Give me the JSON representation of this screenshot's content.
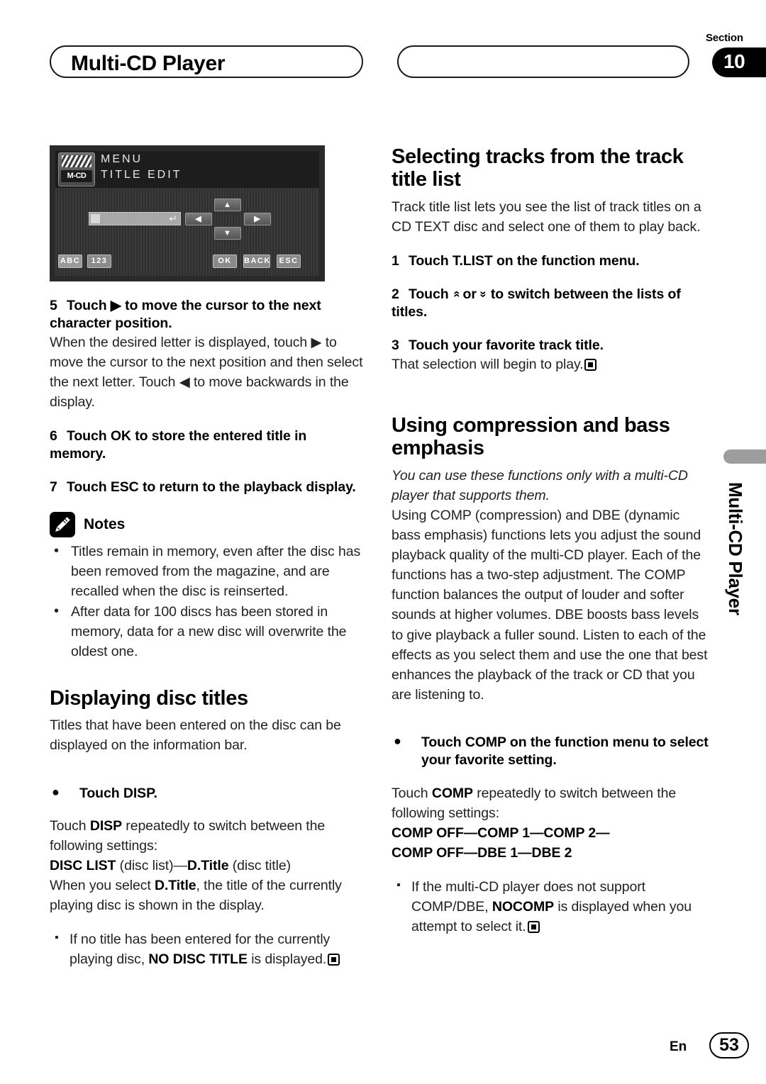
{
  "header": {
    "left_pill_title": "Multi-CD Player",
    "right_pill_title": "",
    "section_word": "Section",
    "section_number": "10"
  },
  "lcd_display": {
    "logo_label": "M-CD",
    "menu_label": "MENU",
    "screen_title": "TITLE EDIT",
    "arrow_left": "◀",
    "arrow_right": "▶",
    "arrow_up": "▲",
    "arrow_down": "▼",
    "enter_symbol": "↵",
    "buttons": [
      "ABC",
      "123",
      "OK",
      "BACK",
      "ESC"
    ]
  },
  "left_column": {
    "step5": {
      "number": "5",
      "title_a": "Touch ",
      "title_icon": "▶",
      "title_b": " to move the cursor to the next character position.",
      "body_1": "When the desired letter is displayed, touch ",
      "body_icon_1": "▶",
      "body_2": " to move the cursor to the next position and then select the next letter. Touch ",
      "body_icon_2": "◀",
      "body_3": " to move backwards in the display."
    },
    "step6": {
      "number": "6",
      "title": "Touch OK to store the entered title in memory."
    },
    "step7": {
      "number": "7",
      "title": "Touch ESC to return to the playback display."
    },
    "notes": {
      "icon_name": "pencil-icon",
      "label": "Notes",
      "items": [
        "Titles remain in memory, even after the disc has been removed from the magazine, and are recalled when the disc is reinserted.",
        "After data for 100 discs has been stored in memory, data for a new disc will overwrite the oldest one."
      ]
    },
    "displaying_disc_titles": {
      "heading": "Displaying disc titles",
      "intro": "Titles that have been entered on the disc can be displayed on the information bar.",
      "bullet_step": "Touch DISP.",
      "para_a": "Touch ",
      "para_bold_1": "DISP",
      "para_b": " repeatedly to switch between the following settings:",
      "settings_bold_1": "DISC LIST",
      "settings_plain_1": " (disc list)—",
      "settings_bold_2": "D.Title",
      "settings_plain_2": " (disc title)",
      "para_c": "When you select ",
      "para_bold_2": "D.Title",
      "para_d": ", the title of the currently playing disc is shown in the display.",
      "sub_note_a": "If no title has been entered for the currently playing disc, ",
      "sub_note_bold": "NO DISC TITLE",
      "sub_note_b": " is displayed."
    }
  },
  "right_column": {
    "selecting_tracks": {
      "heading": "Selecting tracks from the track title list",
      "intro": "Track title list lets you see the list of track titles on a CD TEXT disc and select one of them to play back.",
      "step1": {
        "number": "1",
        "title": "Touch T.LIST on the function menu."
      },
      "step2": {
        "number": "2",
        "title_a": "Touch ",
        "icon_up": "»",
        "title_b": " or ",
        "icon_down": "»",
        "title_c": " to switch between the lists of titles."
      },
      "step3": {
        "number": "3",
        "title": "Touch your favorite track title.",
        "body": "That selection will begin to play."
      }
    },
    "compression": {
      "heading": "Using compression and bass emphasis",
      "italic_note": "You can use these functions only with a multi-CD player that supports them.",
      "body": "Using COMP (compression) and DBE (dynamic bass emphasis) functions lets you adjust the sound playback quality of the multi-CD player. Each of the functions has a two-step adjustment. The COMP function balances the output of louder and softer sounds at higher volumes. DBE boosts bass levels to give playback a fuller sound. Listen to each of the effects as you select them and use the one that best enhances the playback of the track or CD that you are listening to.",
      "bullet_step": "Touch COMP on the function menu to select your favorite setting.",
      "para_a": "Touch ",
      "para_bold": "COMP",
      "para_b": " repeatedly to switch between the following settings:",
      "settings_line_1": "COMP OFF—COMP 1—COMP 2—",
      "settings_line_2": "COMP OFF—DBE 1—DBE 2",
      "sub_note_a": "If the multi-CD player does not support COMP/DBE, ",
      "sub_note_bold": "NOCOMP",
      "sub_note_b": " is displayed when you attempt to select it."
    }
  },
  "side_tab": {
    "label": "Multi-CD Player"
  },
  "footer": {
    "language": "En",
    "page_number": "53"
  },
  "colors": {
    "text": "#000000",
    "body_text": "#222222",
    "lcd_background": "#2a2a2a",
    "side_tab_bar": "#9d9d9d"
  }
}
